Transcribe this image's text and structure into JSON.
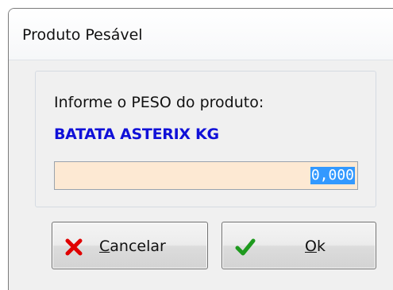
{
  "window": {
    "title": "Produto Pesável"
  },
  "prompt": {
    "label": "Informe o PESO do produto:",
    "product_name": "BATATA ASTERIX KG"
  },
  "weight_input": {
    "value": "0,000"
  },
  "buttons": {
    "cancel": {
      "accel": "C",
      "rest": "ancelar",
      "icon": "x-icon"
    },
    "ok": {
      "accel": "O",
      "rest": "k",
      "icon": "checkmark-icon"
    }
  },
  "colors": {
    "product_name": "#1010d8",
    "input_background": "#fde9d3",
    "selection": "#3399ff",
    "cancel_icon": "#e00000",
    "ok_icon": "#1e9a1e"
  }
}
